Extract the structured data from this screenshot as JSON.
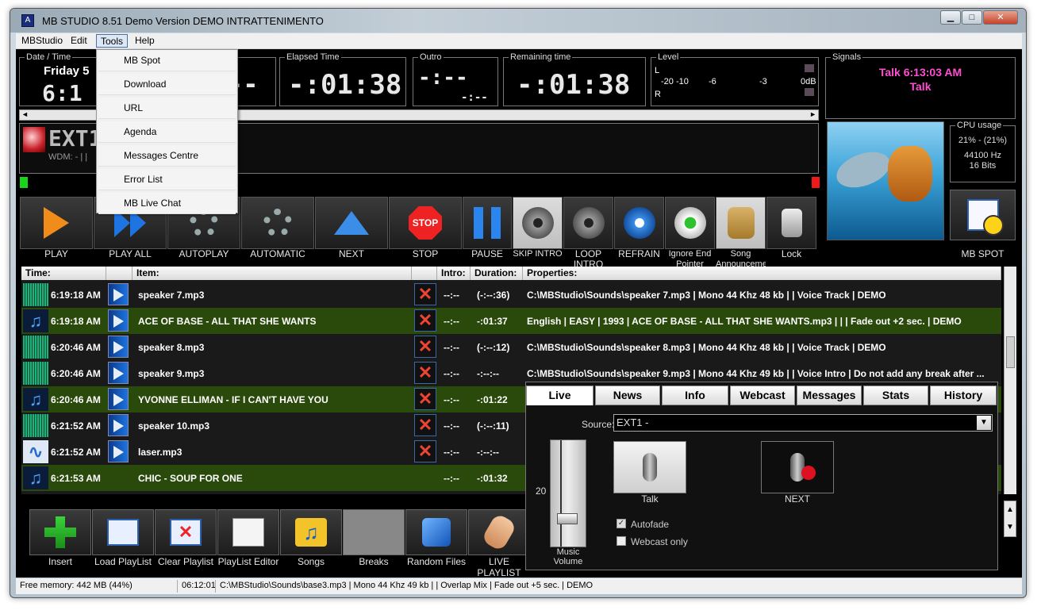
{
  "window": {
    "title": "MB STUDIO  8.51   Demo Version    DEMO    INTRATTENIMENTO",
    "controls": {
      "minimize": "▁",
      "maximize": "□",
      "close": "✕"
    }
  },
  "menu": [
    "MBStudio",
    "Edit",
    "Tools",
    "Help"
  ],
  "tools_dropdown": [
    "MB Spot",
    "Download",
    "URL",
    "Agenda",
    "Messages Centre",
    "Error List",
    "MB Live Chat"
  ],
  "panels": {
    "datetime": {
      "label": "Date / Time",
      "day": "Friday 5",
      "time": "6:1"
    },
    "dash": "--",
    "elapsed": {
      "label": "Elapsed Time",
      "value": "-:01:38"
    },
    "outro": {
      "label": "Outro",
      "value": "-:--",
      "sub": "-:--"
    },
    "remaining": {
      "label": "Remaining time",
      "value": "-:01:38"
    },
    "level": {
      "label": "Level",
      "L": "L",
      "R": "R",
      "scale": [
        "-20 -10",
        "-6",
        "-3",
        "0dB"
      ]
    },
    "signals": {
      "label": "Signals",
      "line1": "Talk 6:13:03 AM",
      "line2": "Talk"
    },
    "cpu": {
      "label": "CPU usage",
      "usage": "21% - (21%)",
      "hz": "44100 Hz",
      "bits": "16 Bits"
    }
  },
  "source_panel": {
    "name": "EXT1",
    "sub": "WDM: - | |"
  },
  "toolbar": [
    {
      "id": "play",
      "label": "PLAY"
    },
    {
      "id": "play-all",
      "label": "PLAY ALL"
    },
    {
      "id": "autoplay",
      "label": "AUTOPLAY"
    },
    {
      "id": "automatic",
      "label": "AUTOMATIC"
    },
    {
      "id": "next",
      "label": "NEXT"
    },
    {
      "id": "stop",
      "label": "STOP",
      "text": "STOP"
    },
    {
      "id": "pause",
      "label": "PAUSE"
    },
    {
      "id": "skip-intro",
      "label": "SKIP INTRO"
    },
    {
      "id": "loop-intro",
      "label": "LOOP INTRO"
    },
    {
      "id": "refrain",
      "label": "REFRAIN"
    },
    {
      "id": "ignore-end-pointer",
      "label": "Ignore End Pointer"
    },
    {
      "id": "song-announcement",
      "label": "Song Announcement"
    },
    {
      "id": "lock",
      "label": "Lock"
    }
  ],
  "mbspot_label": "MB SPOT",
  "playlist": {
    "headers": [
      "Time:",
      "",
      "Item:",
      "",
      "Intro:",
      "Duration:",
      "Properties:"
    ],
    "rows": [
      {
        "time": "6:19:18 AM",
        "icon": "wave",
        "item": "speaker 7.mp3",
        "intro": "--:--",
        "duration": "(-:--:36)",
        "props": "C:\\MBStudio\\Sounds\\speaker 7.mp3 |  Mono 44 Khz 48 kb |  | Voice Track | DEMO",
        "green": false
      },
      {
        "time": "6:19:18 AM",
        "icon": "note",
        "item": "ACE OF BASE - ALL THAT SHE WANTS",
        "intro": "--:--",
        "duration": "-:01:37",
        "props": "English | EASY | 1993 | ACE OF BASE - ALL THAT SHE WANTS.mp3 |  |  | Fade out +2 sec. | DEMO",
        "green": true
      },
      {
        "time": "6:20:46 AM",
        "icon": "wave",
        "item": "speaker 8.mp3",
        "intro": "--:--",
        "duration": "(-:--:12)",
        "props": "C:\\MBStudio\\Sounds\\speaker 8.mp3 |  Mono 44 Khz 48 kb |  | Voice Track | DEMO",
        "green": false
      },
      {
        "time": "6:20:46 AM",
        "icon": "wave",
        "item": "speaker 9.mp3",
        "intro": "--:--",
        "duration": "-:--:--",
        "props": "C:\\MBStudio\\Sounds\\speaker 9.mp3 |  Mono 44 Khz 49 kb |  | Voice Intro | Do not add any break after ...",
        "green": false
      },
      {
        "time": "6:20:46 AM",
        "icon": "note",
        "item": "YVONNE ELLIMAN - IF I CAN'T HAVE YOU",
        "intro": "--:--",
        "duration": "-:01:22",
        "props": "",
        "green": true
      },
      {
        "time": "6:21:52 AM",
        "icon": "wave",
        "item": "speaker 10.mp3",
        "intro": "--:--",
        "duration": "(-:--:11)",
        "props": "",
        "green": false
      },
      {
        "time": "6:21:52 AM",
        "icon": "doc",
        "item": "laser.mp3",
        "intro": "--:--",
        "duration": "-:--:--",
        "props": "",
        "green": false
      },
      {
        "time": "6:21:53 AM",
        "icon": "note",
        "item": "CHIC - SOUP FOR ONE",
        "intro": "--:--",
        "duration": "-:01:32",
        "props": "",
        "green": true
      }
    ]
  },
  "bottom_buttons": [
    {
      "id": "insert",
      "label": "Insert"
    },
    {
      "id": "load-playlist",
      "label": "Load PlayList"
    },
    {
      "id": "clear-playlist",
      "label": "Clear Playlist"
    },
    {
      "id": "playlist-editor",
      "label": "PlayList Editor"
    },
    {
      "id": "songs",
      "label": "Songs"
    },
    {
      "id": "breaks",
      "label": "Breaks"
    },
    {
      "id": "random-files",
      "label": "Random Files"
    },
    {
      "id": "live-playlist",
      "label": "LIVE PLAYLIST"
    }
  ],
  "live_panel": {
    "tabs": [
      "Live",
      "News",
      "Info",
      "Webcast",
      "Messages",
      "Stats",
      "History"
    ],
    "source_label": "Source:",
    "source_value": "EXT1 -",
    "volume_value": "20",
    "volume_label": "Music Volume",
    "talk_label": "Talk",
    "next_label": "NEXT",
    "autofade_label": "Autofade",
    "webcast_label": "Webcast only"
  },
  "status": {
    "memory": "Free memory: 442 MB (44%)",
    "time": "06:12:01",
    "info": "C:\\MBStudio\\Sounds\\base3.mp3 |  Mono 44 Khz 49 kb |  | Overlap Mix | Fade out +5 sec. | DEMO"
  },
  "colors": {
    "accent_green": "#2a4a0c",
    "signal_pink": "#ff4fd0",
    "play_orange": "#f08c1a"
  }
}
